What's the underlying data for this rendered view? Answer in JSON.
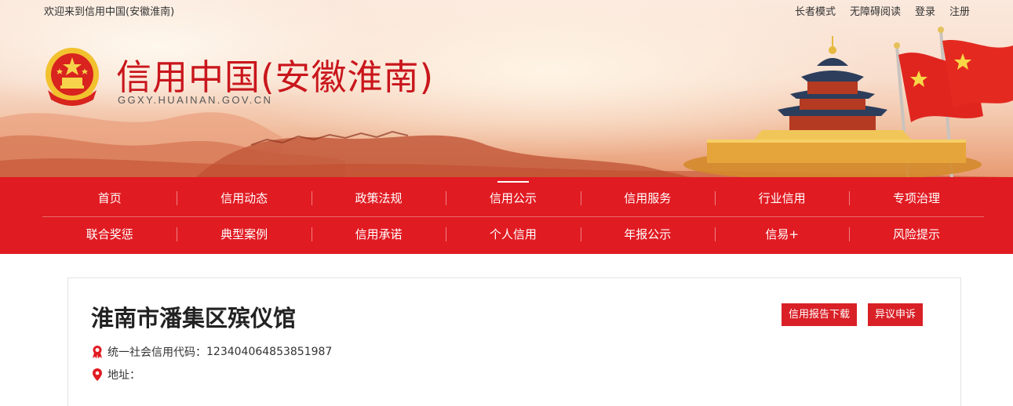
{
  "topbar": {
    "welcome": "欢迎来到信用中国(安徽淮南)",
    "links": [
      "长者模式",
      "无障碍阅读",
      "登录",
      "注册"
    ]
  },
  "header": {
    "title": "信用中国(安徽淮南)",
    "domain": "GGXY.HUAINAN.GOV.CN"
  },
  "nav": {
    "row1": [
      "首页",
      "信用动态",
      "政策法规",
      "信用公示",
      "信用服务",
      "行业信用",
      "专项治理"
    ],
    "row2": [
      "联合奖惩",
      "典型案例",
      "信用承诺",
      "个人信用",
      "年报公示",
      "信易+",
      "风险提示"
    ],
    "active": "信用公示"
  },
  "org": {
    "name": "淮南市潘集区殡仪馆",
    "code_label": "统一社会信用代码：",
    "code_value": "123404064853851987",
    "address_label": "地址：",
    "address_value": ""
  },
  "actions": {
    "report_label": "信用报告下载",
    "appeal_label": "异议申诉"
  },
  "colors": {
    "brand_red": "#e11b22",
    "title_red": "#c9161c",
    "button_red": "#d92027"
  }
}
